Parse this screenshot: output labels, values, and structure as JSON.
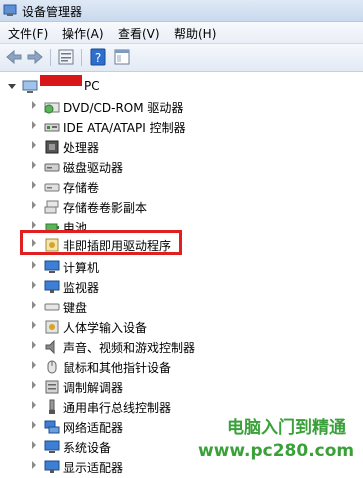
{
  "window": {
    "title": "设备管理器"
  },
  "menu": [
    "文件(F)",
    "操作(A)",
    "查看(V)",
    "帮助(H)"
  ],
  "toolbar": {
    "buttons": [
      "back-icon",
      "forward-icon",
      "properties-icon",
      "help-icon",
      "console-icon"
    ]
  },
  "tree": {
    "root_label": "PC",
    "items": [
      "DVD/CD-ROM 驱动器",
      "IDE ATA/ATAPI 控制器",
      "处理器",
      "磁盘驱动器",
      "存储卷",
      "存储卷卷影副本",
      "电池",
      "非即插即用驱动程序",
      "计算机",
      "监视器",
      "键盘",
      "人体学输入设备",
      "声音、视频和游戏控制器",
      "鼠标和其他指针设备",
      "调制解调器",
      "通用串行总线控制器",
      "网络适配器",
      "系统设备",
      "显示适配器"
    ]
  },
  "watermark": {
    "line1": "电脑入门到精通",
    "line2": "www.pc280.com"
  },
  "colors": {
    "highlight": "#e02020",
    "watermark": "#3aa13a"
  }
}
